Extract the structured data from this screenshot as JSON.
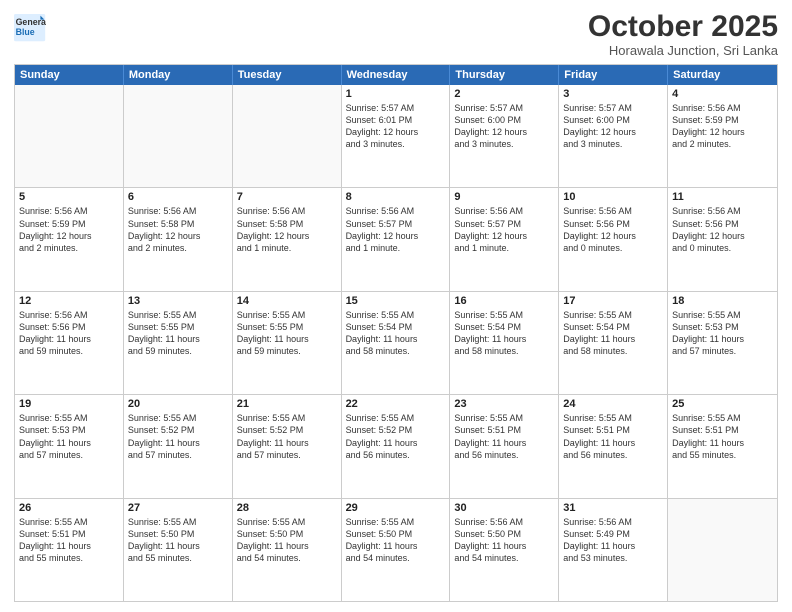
{
  "logo": {
    "general": "General",
    "blue": "Blue"
  },
  "title": "October 2025",
  "location": "Horawala Junction, Sri Lanka",
  "header_days": [
    "Sunday",
    "Monday",
    "Tuesday",
    "Wednesday",
    "Thursday",
    "Friday",
    "Saturday"
  ],
  "weeks": [
    [
      {
        "day": "",
        "text": ""
      },
      {
        "day": "",
        "text": ""
      },
      {
        "day": "",
        "text": ""
      },
      {
        "day": "1",
        "text": "Sunrise: 5:57 AM\nSunset: 6:01 PM\nDaylight: 12 hours\nand 3 minutes."
      },
      {
        "day": "2",
        "text": "Sunrise: 5:57 AM\nSunset: 6:00 PM\nDaylight: 12 hours\nand 3 minutes."
      },
      {
        "day": "3",
        "text": "Sunrise: 5:57 AM\nSunset: 6:00 PM\nDaylight: 12 hours\nand 3 minutes."
      },
      {
        "day": "4",
        "text": "Sunrise: 5:56 AM\nSunset: 5:59 PM\nDaylight: 12 hours\nand 2 minutes."
      }
    ],
    [
      {
        "day": "5",
        "text": "Sunrise: 5:56 AM\nSunset: 5:59 PM\nDaylight: 12 hours\nand 2 minutes."
      },
      {
        "day": "6",
        "text": "Sunrise: 5:56 AM\nSunset: 5:58 PM\nDaylight: 12 hours\nand 2 minutes."
      },
      {
        "day": "7",
        "text": "Sunrise: 5:56 AM\nSunset: 5:58 PM\nDaylight: 12 hours\nand 1 minute."
      },
      {
        "day": "8",
        "text": "Sunrise: 5:56 AM\nSunset: 5:57 PM\nDaylight: 12 hours\nand 1 minute."
      },
      {
        "day": "9",
        "text": "Sunrise: 5:56 AM\nSunset: 5:57 PM\nDaylight: 12 hours\nand 1 minute."
      },
      {
        "day": "10",
        "text": "Sunrise: 5:56 AM\nSunset: 5:56 PM\nDaylight: 12 hours\nand 0 minutes."
      },
      {
        "day": "11",
        "text": "Sunrise: 5:56 AM\nSunset: 5:56 PM\nDaylight: 12 hours\nand 0 minutes."
      }
    ],
    [
      {
        "day": "12",
        "text": "Sunrise: 5:56 AM\nSunset: 5:56 PM\nDaylight: 11 hours\nand 59 minutes."
      },
      {
        "day": "13",
        "text": "Sunrise: 5:55 AM\nSunset: 5:55 PM\nDaylight: 11 hours\nand 59 minutes."
      },
      {
        "day": "14",
        "text": "Sunrise: 5:55 AM\nSunset: 5:55 PM\nDaylight: 11 hours\nand 59 minutes."
      },
      {
        "day": "15",
        "text": "Sunrise: 5:55 AM\nSunset: 5:54 PM\nDaylight: 11 hours\nand 58 minutes."
      },
      {
        "day": "16",
        "text": "Sunrise: 5:55 AM\nSunset: 5:54 PM\nDaylight: 11 hours\nand 58 minutes."
      },
      {
        "day": "17",
        "text": "Sunrise: 5:55 AM\nSunset: 5:54 PM\nDaylight: 11 hours\nand 58 minutes."
      },
      {
        "day": "18",
        "text": "Sunrise: 5:55 AM\nSunset: 5:53 PM\nDaylight: 11 hours\nand 57 minutes."
      }
    ],
    [
      {
        "day": "19",
        "text": "Sunrise: 5:55 AM\nSunset: 5:53 PM\nDaylight: 11 hours\nand 57 minutes."
      },
      {
        "day": "20",
        "text": "Sunrise: 5:55 AM\nSunset: 5:52 PM\nDaylight: 11 hours\nand 57 minutes."
      },
      {
        "day": "21",
        "text": "Sunrise: 5:55 AM\nSunset: 5:52 PM\nDaylight: 11 hours\nand 57 minutes."
      },
      {
        "day": "22",
        "text": "Sunrise: 5:55 AM\nSunset: 5:52 PM\nDaylight: 11 hours\nand 56 minutes."
      },
      {
        "day": "23",
        "text": "Sunrise: 5:55 AM\nSunset: 5:51 PM\nDaylight: 11 hours\nand 56 minutes."
      },
      {
        "day": "24",
        "text": "Sunrise: 5:55 AM\nSunset: 5:51 PM\nDaylight: 11 hours\nand 56 minutes."
      },
      {
        "day": "25",
        "text": "Sunrise: 5:55 AM\nSunset: 5:51 PM\nDaylight: 11 hours\nand 55 minutes."
      }
    ],
    [
      {
        "day": "26",
        "text": "Sunrise: 5:55 AM\nSunset: 5:51 PM\nDaylight: 11 hours\nand 55 minutes."
      },
      {
        "day": "27",
        "text": "Sunrise: 5:55 AM\nSunset: 5:50 PM\nDaylight: 11 hours\nand 55 minutes."
      },
      {
        "day": "28",
        "text": "Sunrise: 5:55 AM\nSunset: 5:50 PM\nDaylight: 11 hours\nand 54 minutes."
      },
      {
        "day": "29",
        "text": "Sunrise: 5:55 AM\nSunset: 5:50 PM\nDaylight: 11 hours\nand 54 minutes."
      },
      {
        "day": "30",
        "text": "Sunrise: 5:56 AM\nSunset: 5:50 PM\nDaylight: 11 hours\nand 54 minutes."
      },
      {
        "day": "31",
        "text": "Sunrise: 5:56 AM\nSunset: 5:49 PM\nDaylight: 11 hours\nand 53 minutes."
      },
      {
        "day": "",
        "text": ""
      }
    ]
  ]
}
